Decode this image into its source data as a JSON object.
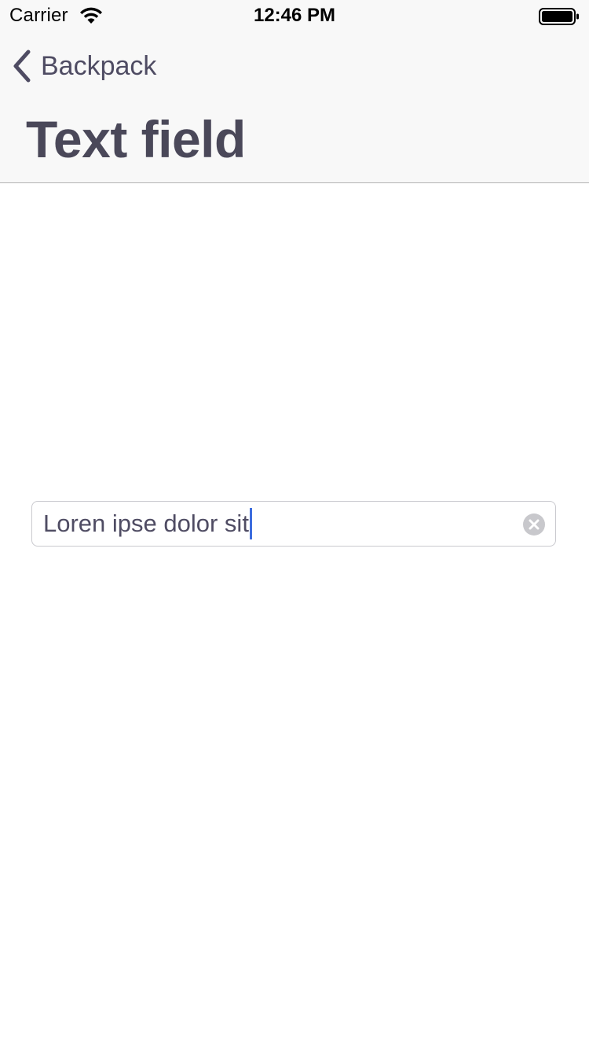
{
  "status_bar": {
    "carrier": "Carrier",
    "time": "12:46 PM",
    "icons": [
      "wifi-icon",
      "battery-icon"
    ]
  },
  "nav": {
    "back_label": "Backpack",
    "back_icon": "chevron-left-icon",
    "title": "Text field"
  },
  "text_field": {
    "value": "Loren ipse dolor sit",
    "clear_icon": "clear-icon",
    "caret_color": "#3d6dde"
  },
  "colors": {
    "text_primary": "#4f4c63",
    "nav_background": "#f8f8f8",
    "caret": "#3d6dde"
  }
}
